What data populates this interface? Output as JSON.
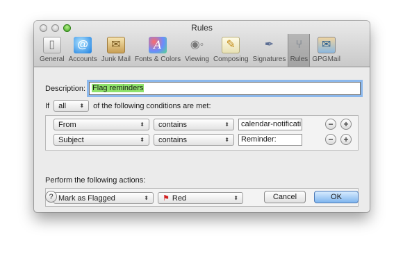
{
  "window": {
    "title": "Rules"
  },
  "toolbar": {
    "items": [
      {
        "label": "General",
        "icon": "general-icon"
      },
      {
        "label": "Accounts",
        "icon": "accounts-icon"
      },
      {
        "label": "Junk Mail",
        "icon": "junk-mail-icon"
      },
      {
        "label": "Fonts & Colors",
        "icon": "fonts-colors-icon"
      },
      {
        "label": "Viewing",
        "icon": "viewing-icon"
      },
      {
        "label": "Composing",
        "icon": "composing-icon"
      },
      {
        "label": "Signatures",
        "icon": "signatures-icon"
      },
      {
        "label": "Rules",
        "icon": "rules-icon",
        "selected": true
      },
      {
        "label": "GPGMail",
        "icon": "gpgmail-icon"
      }
    ]
  },
  "rule": {
    "description_label": "Description:",
    "description_value": "Flag reminders",
    "if_label": "If",
    "match_mode": "all",
    "conditions_suffix": "of the following conditions are met:",
    "conditions": [
      {
        "field": "From",
        "operator": "contains",
        "value": "calendar-notificati"
      },
      {
        "field": "Subject",
        "operator": "contains",
        "value": "Reminder:"
      }
    ],
    "actions_label": "Perform the following actions:",
    "actions": [
      {
        "action": "Mark as Flagged",
        "flag_color": "Red",
        "flag_hex": "#d22020"
      }
    ]
  },
  "buttons": {
    "help": "?",
    "cancel": "Cancel",
    "ok": "OK",
    "add": "+",
    "remove": "−"
  },
  "icons": {
    "popup_arrows": "⬍",
    "flag": "⚑"
  }
}
